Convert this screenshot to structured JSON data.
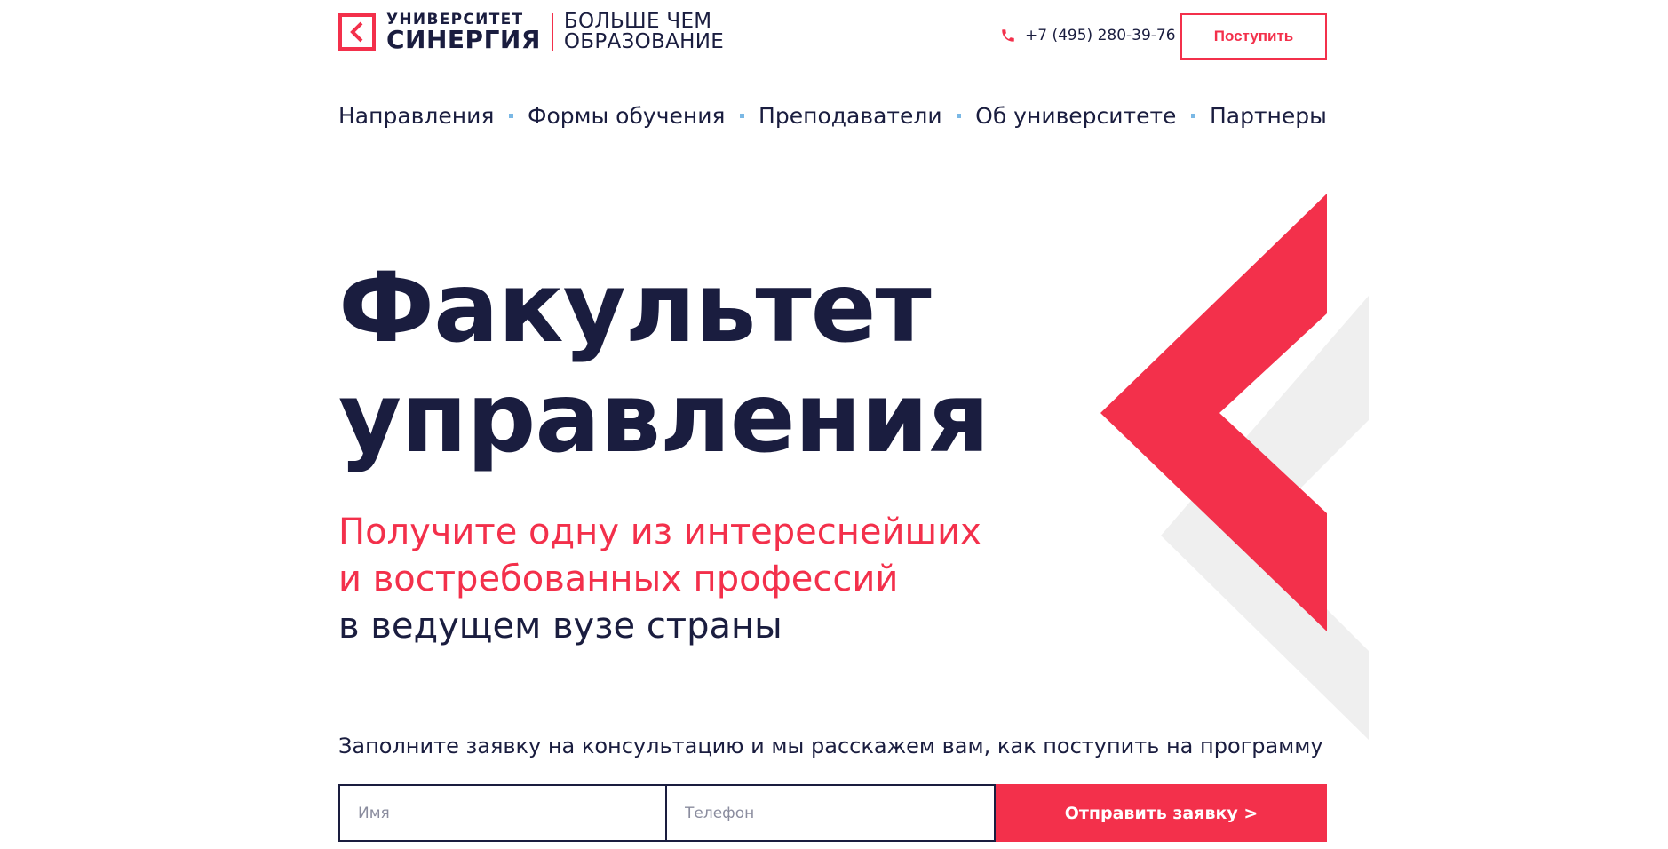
{
  "brand": {
    "line1": "УНИВЕРСИТЕТ",
    "line2": "СИНЕРГИЯ",
    "slogan_line1": "БОЛЬШЕ ЧЕМ",
    "slogan_line2": "ОБРАЗОВАНИЕ",
    "accent_color": "#f3304b",
    "text_color": "#1a1d3f"
  },
  "header": {
    "phone": "+7 (495) 280-39-76",
    "apply_label": "Поступить"
  },
  "nav": {
    "items": [
      {
        "label": "Направления"
      },
      {
        "label": "Формы обучения"
      },
      {
        "label": "Преподаватели"
      },
      {
        "label": "Об университете"
      },
      {
        "label": "Партнеры"
      }
    ]
  },
  "hero": {
    "title_line1": "Факультет",
    "title_line2": "управления",
    "sub_line1": "Получите одну из интереснейших",
    "sub_line2": "и востребованных профессий",
    "sub_line3": "в ведущем вузе страны"
  },
  "form": {
    "caption": "Заполните заявку на консультацию и мы расскажем вам, как поступить на программу",
    "name_placeholder": "Имя",
    "phone_placeholder": "Телефон",
    "name_value": "",
    "phone_value": "",
    "submit_label": "Отправить заявку >"
  }
}
